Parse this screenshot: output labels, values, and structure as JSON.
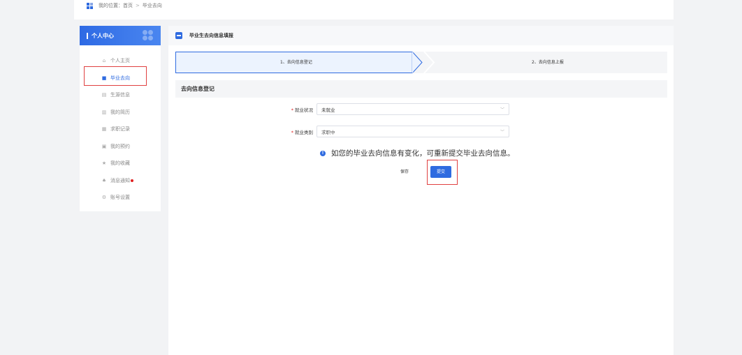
{
  "breadcrumb": {
    "prefix": "我的位置：",
    "home": "首页",
    "separator": ">",
    "current": "毕业去向"
  },
  "sidebar": {
    "title": "个人中心",
    "items": [
      {
        "label": "个人主页",
        "icon": "home-icon",
        "glyph": "⌂"
      },
      {
        "label": "毕业去向",
        "icon": "graduation-icon",
        "glyph": "■"
      },
      {
        "label": "生源信息",
        "icon": "profile-card-icon",
        "glyph": "▤"
      },
      {
        "label": "我的简历",
        "icon": "resume-icon",
        "glyph": "▥"
      },
      {
        "label": "求职记录",
        "icon": "record-icon",
        "glyph": "▦"
      },
      {
        "label": "我的预约",
        "icon": "calendar-icon",
        "glyph": "▣"
      },
      {
        "label": "我的收藏",
        "icon": "star-icon",
        "glyph": "★"
      },
      {
        "label": "消息通知",
        "icon": "bell-icon",
        "glyph": "♠"
      },
      {
        "label": "账号设置",
        "icon": "gear-icon",
        "glyph": "⚙"
      }
    ]
  },
  "main": {
    "title": "毕业生去向信息填报",
    "steps": [
      "1、去向信息登记",
      "2、去向信息上报"
    ],
    "section_title": "去向信息登记",
    "fields": {
      "employment_status": {
        "label": "就业状况",
        "value": "未就业"
      },
      "employment_type": {
        "label": "就业类别",
        "value": "求职中"
      }
    },
    "notice": "如您的毕业去向信息有变化，可重新提交毕业去向信息。",
    "save_label": "保存",
    "submit_label": "提交"
  },
  "colors": {
    "accent": "#2f6be0",
    "highlight": "#e04040",
    "required": "#e02020"
  }
}
